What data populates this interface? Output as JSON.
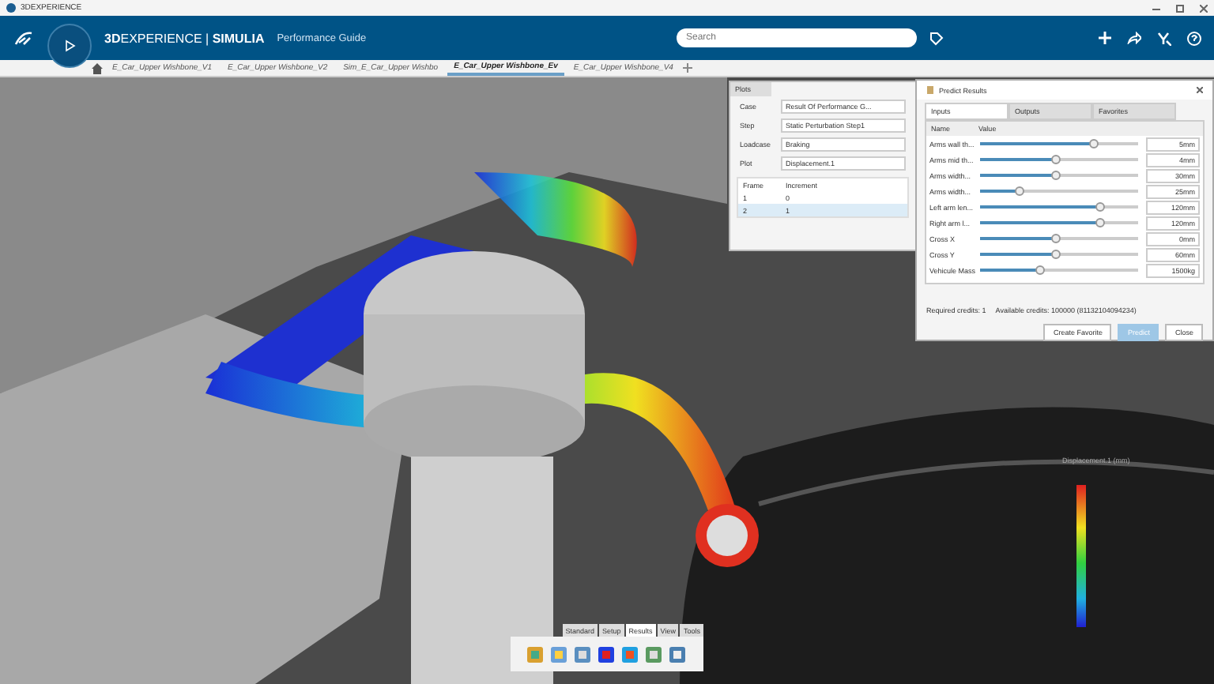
{
  "window": {
    "title": "3DEXPERIENCE"
  },
  "app_bar": {
    "brand": "**3D**EXPERIENCE | **SIMULIA**",
    "app_name": "Performance Guide",
    "search": {
      "placeholder": "Search"
    }
  },
  "tabs": [
    {
      "label": "E_Car_Upper Wishbone_V1",
      "selected": false
    },
    {
      "label": "E_Car_Upper Wishbone_V2",
      "selected": false
    },
    {
      "label": "Sim_E_Car_Upper Wishbo",
      "selected": false
    },
    {
      "label": "E_Car_Upper Wishbone_Ev",
      "selected": true
    },
    {
      "label": "E_Car_Upper Wishbone_V4",
      "selected": false
    }
  ],
  "plots_panel": {
    "title": "Plots",
    "fields": [
      {
        "label": "Case",
        "value": "Result Of Performance G..."
      },
      {
        "label": "Step",
        "value": "Static Perturbation Step1"
      },
      {
        "label": "Loadcase",
        "value": "Braking"
      },
      {
        "label": "Plot",
        "value": "Displacement.1"
      }
    ],
    "columns": [
      "Frame",
      "Increment"
    ],
    "rows": [
      {
        "cells": [
          "1",
          "0"
        ],
        "selected": false
      },
      {
        "cells": [
          "2",
          "1"
        ],
        "selected": true
      }
    ]
  },
  "predict_panel": {
    "title": "Predict Results",
    "tabs": [
      {
        "label": "Inputs",
        "selected": true
      },
      {
        "label": "Outputs",
        "selected": false
      },
      {
        "label": "Favorites",
        "selected": false
      }
    ],
    "columns": [
      "Name",
      "Value"
    ],
    "inputs": [
      {
        "name": "Arms wall th...",
        "level": 0.72,
        "value": "5mm"
      },
      {
        "name": "Arms mid th...",
        "level": 0.48,
        "value": "4mm"
      },
      {
        "name": "Arms width...",
        "level": 0.48,
        "value": "30mm"
      },
      {
        "name": "Arms width...",
        "level": 0.25,
        "value": "25mm"
      },
      {
        "name": "Left arm len...",
        "level": 0.76,
        "value": "120mm"
      },
      {
        "name": "Right arm l...",
        "level": 0.76,
        "value": "120mm"
      },
      {
        "name": "Cross X",
        "level": 0.48,
        "value": "0mm"
      },
      {
        "name": "Cross Y",
        "level": 0.48,
        "value": "60mm"
      },
      {
        "name": "Vehicule Mass",
        "level": 0.38,
        "value": "1500kg"
      }
    ],
    "required_credits": "Required credits:  1",
    "available_credits": "Available credits: 100000 (81132104094234)",
    "buttons": [
      {
        "label": "Create Favorite",
        "kind": "normal"
      },
      {
        "label": "Predict",
        "kind": "primary"
      },
      {
        "label": "Close",
        "kind": "normal"
      }
    ]
  },
  "legend": {
    "title": "Displacement.1 (mm)"
  },
  "toolbar": {
    "tabs": [
      {
        "label": "Standard",
        "selected": false
      },
      {
        "label": "Setup",
        "selected": false
      },
      {
        "label": "Results",
        "selected": true
      },
      {
        "label": "View",
        "selected": false
      },
      {
        "label": "Tools",
        "selected": false
      }
    ]
  }
}
